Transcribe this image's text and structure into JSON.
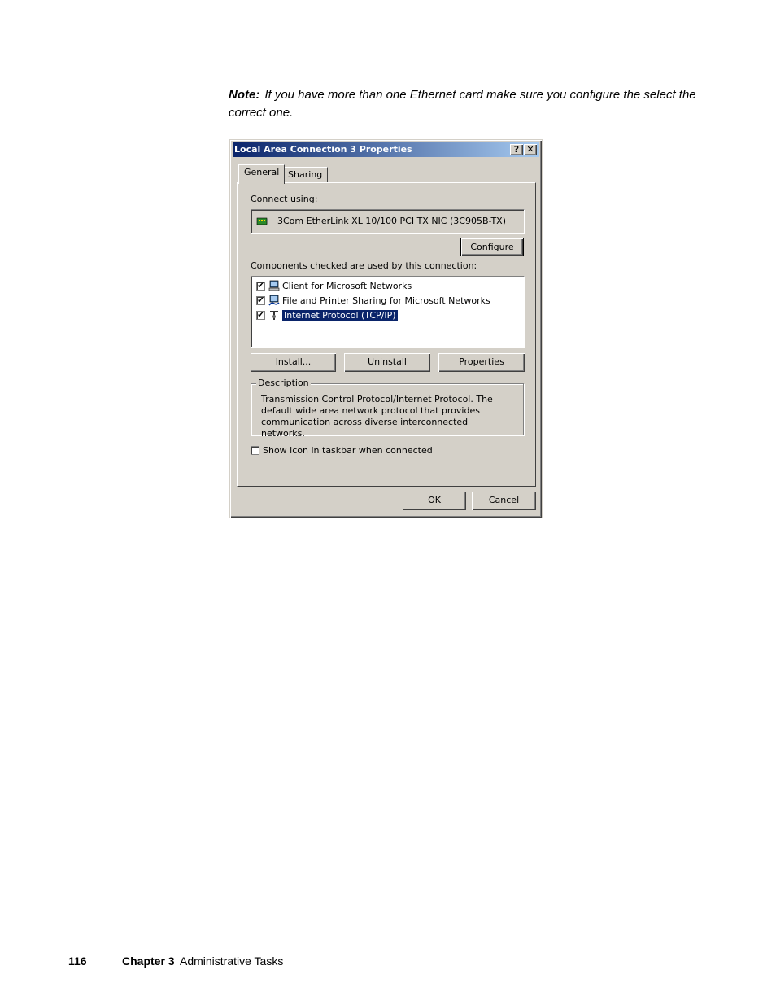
{
  "note": {
    "label": "Note:",
    "text": "If you have more than one Ethernet card make sure you configure the select the correct one."
  },
  "dialog": {
    "title": "Local Area Connection 3 Properties",
    "help_btn": "?",
    "close_btn": "✕",
    "tabs": [
      {
        "label": "General",
        "active": true
      },
      {
        "label": "Sharing",
        "active": false
      }
    ],
    "connect_using_label": "Connect using:",
    "adapter": "3Com EtherLink XL 10/100 PCI TX NIC (3C905B-TX)",
    "configure_label": "Configure",
    "components_label": "Components checked are used by this connection:",
    "components": [
      {
        "label": "Client for Microsoft Networks",
        "checked": true,
        "icon": "network-client-icon",
        "selected": false
      },
      {
        "label": "File and Printer Sharing for Microsoft Networks",
        "checked": true,
        "icon": "file-printer-sharing-icon",
        "selected": false
      },
      {
        "label": "Internet Protocol (TCP/IP)",
        "checked": true,
        "icon": "protocol-icon",
        "selected": true
      }
    ],
    "install_label": "Install...",
    "uninstall_label": "Uninstall",
    "properties_label": "Properties",
    "description_legend": "Description",
    "description_text": "Transmission Control Protocol/Internet Protocol. The default wide area network protocol that provides communication across diverse interconnected networks.",
    "show_icon_label": "Show icon in taskbar when connected",
    "show_icon_checked": false,
    "ok_label": "OK",
    "cancel_label": "Cancel"
  },
  "footer": {
    "page_number": "116",
    "chapter": "Chapter 3",
    "title": "Administrative Tasks"
  },
  "colors": {
    "dialog_face": "#d4d0c8",
    "title_bar": "#0a246a",
    "selection": "#0a246a"
  }
}
